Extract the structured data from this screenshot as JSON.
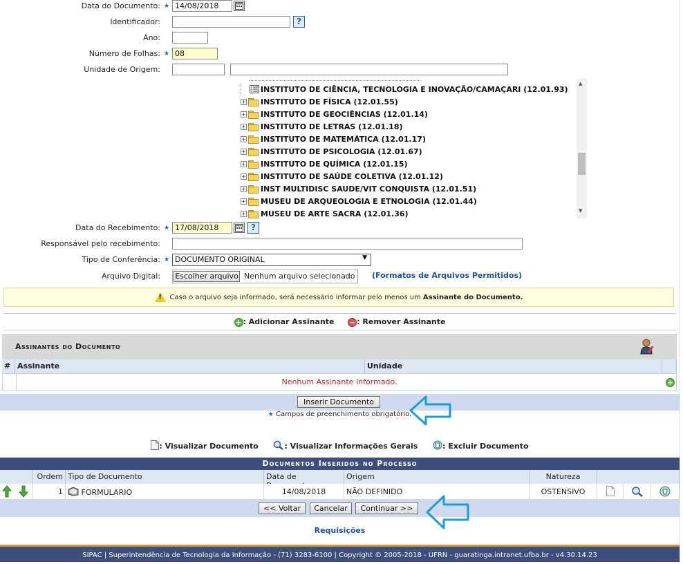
{
  "form": {
    "data_documento_label": "Data do Documento:",
    "data_documento_value": "14/08/2018",
    "identificador_label": "Identificador:",
    "identificador_value": "",
    "ano_label": "Ano:",
    "ano_value": "",
    "numero_folhas_label": "Número de Folhas:",
    "numero_folhas_value": "08",
    "unidade_origem_label": "Unidade de Origem:",
    "unidade_origem_code": "",
    "unidade_origem_name": "",
    "data_recebimento_label": "Data do Recebimento:",
    "data_recebimento_value": "17/08/2018",
    "responsavel_label": "Responsável pelo recebimento:",
    "responsavel_value": "",
    "tipo_conferencia_label": "Tipo de Conferência:",
    "tipo_conferencia_value": "DOCUMENTO ORIGINAL",
    "arquivo_digital_label": "Arquivo Digital:",
    "file_button": "Escolher arquivo",
    "file_status": "Nenhum arquivo selecionado",
    "formatos_link": "(Formatos de Arquivos Permitidos)",
    "help_glyph": "?"
  },
  "tree": {
    "items": [
      {
        "label": "INSTITUTO DE CIÊNCIA, TECNOLOGIA E INOVAÇÃO/CAMAÇARI (12.01.93)",
        "kind": "document"
      },
      {
        "label": "INSTITUTO DE FÍSICA (12.01.55)",
        "kind": "folder"
      },
      {
        "label": "INSTITUTO DE GEOCIÊNCIAS (12.01.14)",
        "kind": "folder"
      },
      {
        "label": "INSTITUTO DE LETRAS (12.01.18)",
        "kind": "folder"
      },
      {
        "label": "INSTITUTO DE MATEMÁTICA (12.01.17)",
        "kind": "folder"
      },
      {
        "label": "INSTITUTO DE PSICOLOGIA (12.01.67)",
        "kind": "folder"
      },
      {
        "label": "INSTITUTO DE QUÍMICA (12.01.15)",
        "kind": "folder"
      },
      {
        "label": "INSTITUTO DE SAÚDE COLETIVA (12.01.12)",
        "kind": "folder"
      },
      {
        "label": "INST MULTIDISC SAUDE/VIT CONQUISTA (12.01.51)",
        "kind": "folder"
      },
      {
        "label": "MUSEU DE ARQUEOLOGIA E ETNOLOGIA (12.01.44)",
        "kind": "folder"
      },
      {
        "label": "MUSEU DE ARTE SACRA (12.01.36)",
        "kind": "folder"
      }
    ]
  },
  "warning": {
    "text_prefix": "Caso o arquivo seja informado, será necessário informar pelo menos um ",
    "text_bold": "Assinante do Documento."
  },
  "assinantes": {
    "add_label": ": Adicionar Assinante",
    "remove_label": ": Remover Assinante",
    "title": "Assinantes do Documento",
    "col_num": "#",
    "col_assinante": "Assinante",
    "col_unidade": "Unidade",
    "empty_message": "Nenhum Assinante Informado."
  },
  "actions": {
    "inserir": "Inserir Documento",
    "required_note": "Campos de preenchimento obrigatório."
  },
  "legend": {
    "visualizar": ": Visualizar Documento",
    "informacoes": ": Visualizar Informações Gerais",
    "excluir": ": Excluir Documento"
  },
  "documentos": {
    "title": "Documentos Inseridos no Processo",
    "columns": {
      "ordem": "Ordem",
      "tipo": "Tipo de Documento",
      "data": "Data de Documento",
      "origem": "Origem",
      "natureza": "Natureza"
    },
    "rows": [
      {
        "ordem": "1",
        "tipo": "FORMULARIO",
        "data": "14/08/2018",
        "origem": "NÃO DEFINIDO",
        "natureza": "OSTENSIVO"
      }
    ]
  },
  "nav": {
    "voltar": "<< Voltar",
    "cancelar": "Cancelar",
    "continuar": "Continuar >>",
    "requisicoes": "Requisições"
  },
  "footer": {
    "text": "SIPAC | Superintendência de Tecnologia da Informação - (71) 3283-6100 | Copyright © 2005-2018 - UFRN - guaratinga.intranet.ufba.br - v4.30.14.23"
  },
  "colors": {
    "accent_blue": "#1a5fb4",
    "header_dark": "#3d4d7c",
    "band_light": "#cfdaf0",
    "hint_arrow": "#1e9be0",
    "required_star": "#1a5fb4",
    "error_text": "#c0282d",
    "input_highlight": "#ffffcc"
  }
}
